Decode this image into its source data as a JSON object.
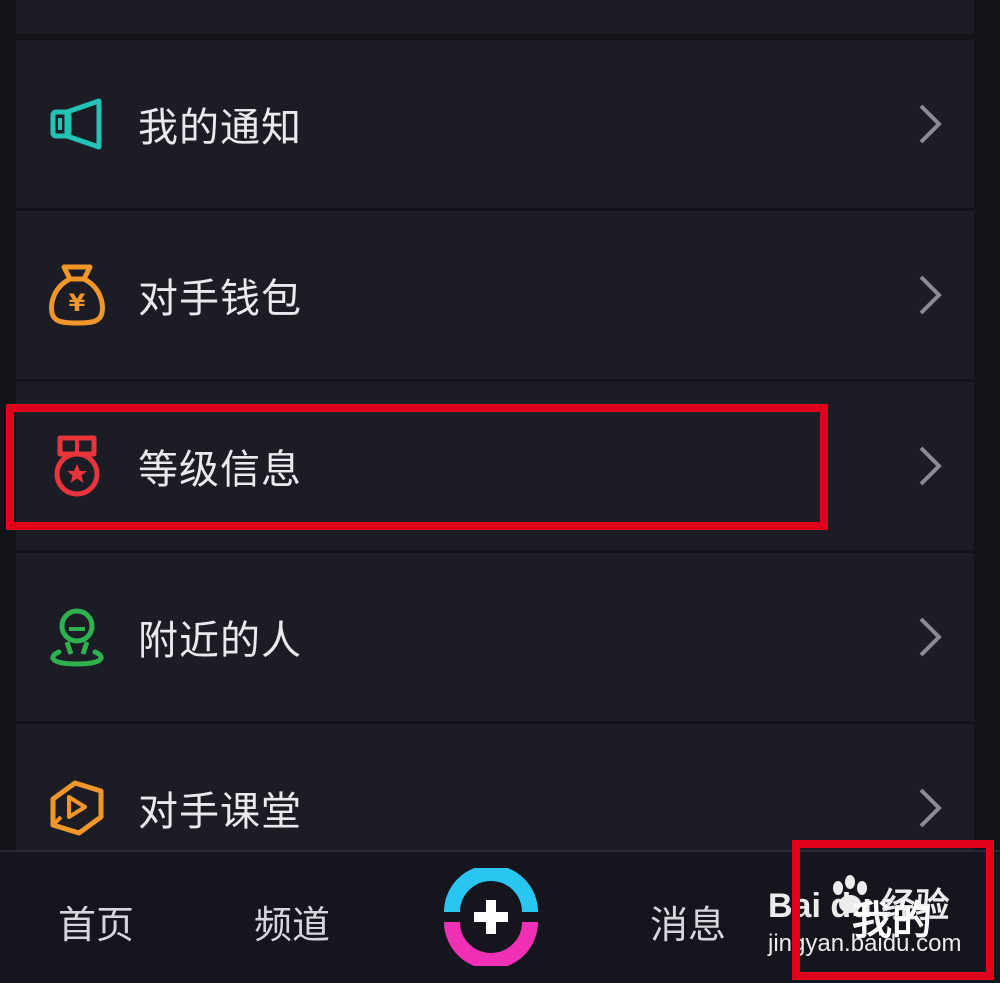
{
  "menu": {
    "items": [
      {
        "label": "我的通知",
        "icon": "megaphone-icon",
        "color": "#22c3b5"
      },
      {
        "label": "对手钱包",
        "icon": "money-bag-icon",
        "color": "#f0962a"
      },
      {
        "label": "等级信息",
        "icon": "medal-icon",
        "color": "#e8343c"
      },
      {
        "label": "附近的人",
        "icon": "person-location-icon",
        "color": "#2fb14f"
      },
      {
        "label": "对手课堂",
        "icon": "classroom-play-icon",
        "color": "#f0962a"
      }
    ]
  },
  "tabbar": {
    "home": "首页",
    "channel": "频道",
    "messages": "消息",
    "mine": "我的",
    "center_icon": "plus-icon"
  },
  "watermark": {
    "brand": "Bai du 经验",
    "url": "jingyan.baidu.com"
  },
  "colors": {
    "background": "#121319",
    "row": "#1b1c24",
    "highlight": "#e0001b",
    "center_top": "#29c6f2",
    "center_bottom": "#ef2fb4"
  }
}
